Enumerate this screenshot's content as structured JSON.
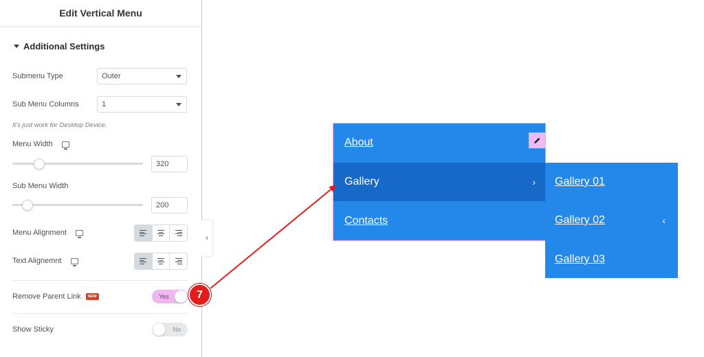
{
  "panel": {
    "title": "Edit Vertical Menu",
    "section_title": "Additional Settings",
    "submenu_type": {
      "label": "Submenu Type",
      "value": "Outer"
    },
    "submenu_columns": {
      "label": "Sub Menu Columns",
      "value": "1"
    },
    "note": "It's just work for Desktop Device.",
    "menu_width": {
      "label": "Menu Width",
      "value": "320",
      "slider_fraction": 0.2
    },
    "submenu_width": {
      "label": "Sub Menu Width",
      "value": "200",
      "slider_fraction": 0.11
    },
    "menu_alignment": {
      "label": "Menu Alignment",
      "selected": "left"
    },
    "text_alignment": {
      "label": "Text Alignemnt",
      "selected": "left"
    },
    "remove_parent_link": {
      "label": "Remove Parent Link",
      "badge": "NEW",
      "state": "Yes"
    },
    "show_sticky": {
      "label": "Show Sticky",
      "state": "No"
    }
  },
  "menu": {
    "items": [
      {
        "label": "About"
      },
      {
        "label": "Gallery"
      },
      {
        "label": "Contacts"
      }
    ],
    "submenu": [
      {
        "label": "Gallery 01"
      },
      {
        "label": "Gallery 02"
      },
      {
        "label": "Gallery 03"
      }
    ],
    "chevron_right": "›",
    "chevron_left": "‹"
  },
  "annotation": {
    "step": "7"
  },
  "colors": {
    "menu_bg": "#2388ea",
    "menu_active": "#1669c9",
    "toggle_on": "#efb8f0",
    "step_badge": "#e51c1c"
  }
}
